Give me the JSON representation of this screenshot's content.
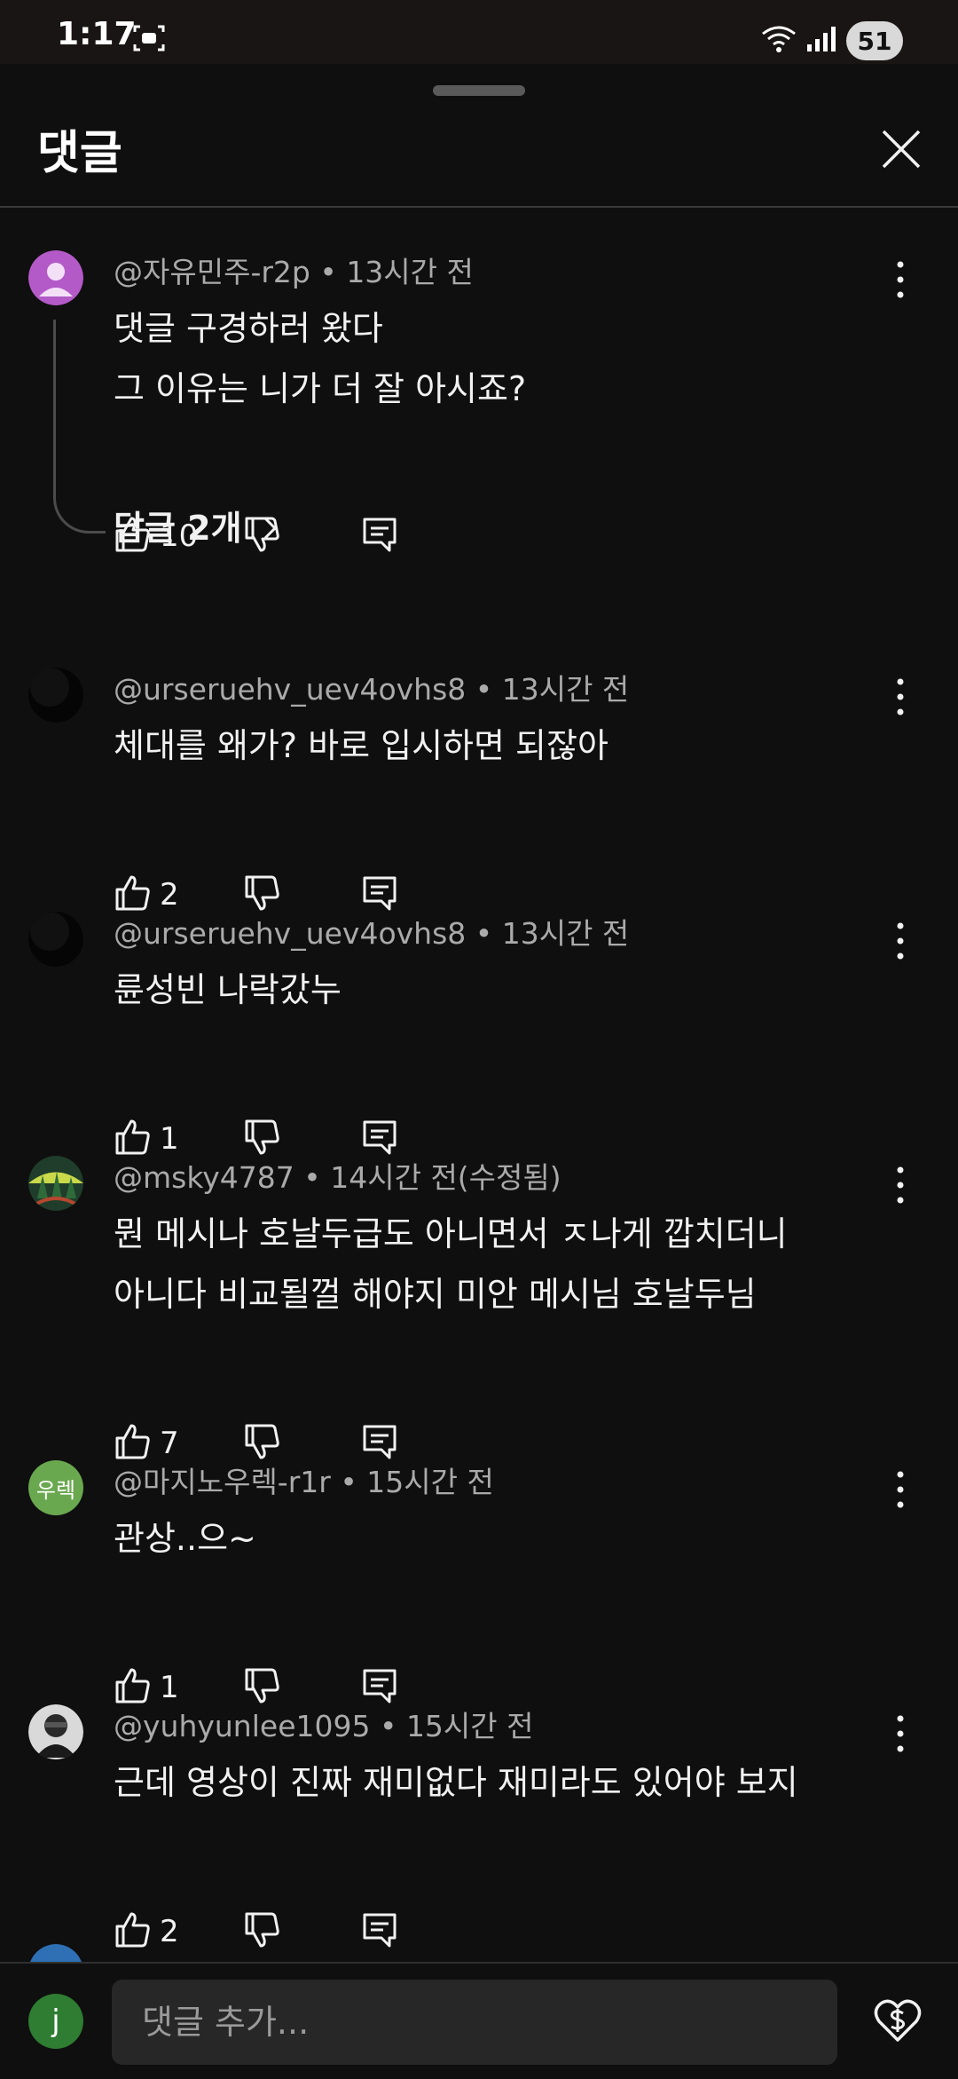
{
  "status_bar": {
    "time": "1:17",
    "battery": "51"
  },
  "sheet": {
    "title": "댓글"
  },
  "comments": [
    {
      "author": "@자유민주-r2p",
      "time": "13시간 전",
      "lines": [
        "댓글 구경하러 왔다",
        "그 이유는 니가 더 잘 아시죠?"
      ],
      "likes": "10",
      "replies_label": "답글 2개"
    },
    {
      "author": "@urseruehv_uev4ovhs8",
      "time": "13시간 전",
      "lines": [
        "체대를 왜가? 바로 입시하면 되잖아"
      ],
      "likes": "2"
    },
    {
      "author": "@urseruehv_uev4ovhs8",
      "time": "13시간 전",
      "lines": [
        "륜성빈 나락갔누"
      ],
      "likes": "1"
    },
    {
      "author": "@msky4787",
      "time": "14시간 전(수정됨)",
      "lines": [
        "뭔 메시나 호날두급도 아니면서 ㅈ나게 깝치더니",
        "아니다 비교될껄 해야지 미안 메시님 호날두님"
      ],
      "likes": "7"
    },
    {
      "author": "@마지노우렉-r1r",
      "avatar_text": "우렉",
      "time": "15시간 전",
      "lines": [
        "관상..으~"
      ],
      "likes": "1"
    },
    {
      "author": "@yuhyunlee1095",
      "time": "15시간 전",
      "lines": [
        "근데 영상이 진짜 재미없다 재미라도 있어야 보지"
      ],
      "likes": "2"
    }
  ],
  "composer": {
    "avatar_letter": "j",
    "placeholder": "댓글 추가..."
  },
  "colors": {
    "background": "#0f0f0f",
    "meta_text": "#aaaaaa",
    "avatar_purple": "#b45ac8",
    "avatar_green": "#6aa84f"
  }
}
